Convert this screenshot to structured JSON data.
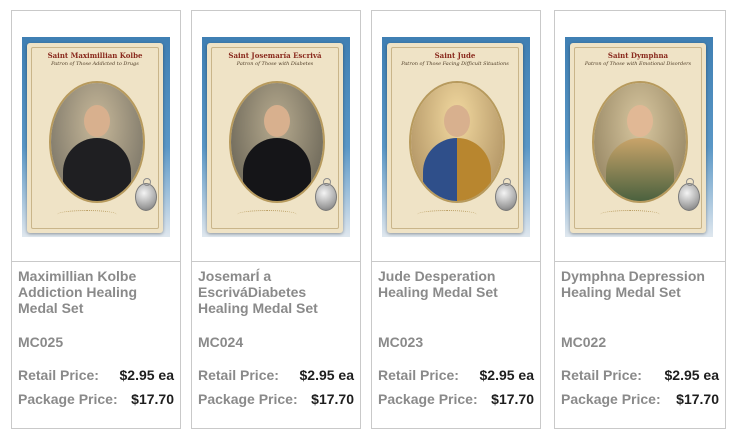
{
  "products": [
    {
      "card_saint": "Saint Maximillian Kolbe",
      "card_patron": "Patron of Those Addicted to Drugs",
      "title": "Maximillian Kolbe Addiction Healing Medal Set",
      "code": "MC025",
      "retail_label": "Retail Price:",
      "retail_price": "$2.95 ea",
      "package_label": "Package Price:",
      "package_price": "$17.70"
    },
    {
      "card_saint": "Saint Josemaría Escrivá",
      "card_patron": "Patron of Those with Diabetes",
      "title": "JosemarÍ a EscriváDiabetes Healing Medal Set",
      "code": "MC024",
      "retail_label": "Retail Price:",
      "retail_price": "$2.95 ea",
      "package_label": "Package Price:",
      "package_price": "$17.70"
    },
    {
      "card_saint": "Saint Jude",
      "card_patron": "Patron of Those Facing Difficult Situations",
      "title": "Jude Desperation Healing Medal Set",
      "code": "MC023",
      "retail_label": "Retail Price:",
      "retail_price": "$2.95 ea",
      "package_label": "Package Price:",
      "package_price": "$17.70"
    },
    {
      "card_saint": "Saint Dymphna",
      "card_patron": "Patron of Those with Emotional Disorders",
      "title": "Dymphna Depression Healing Medal Set",
      "code": "MC022",
      "retail_label": "Retail Price:",
      "retail_price": "$2.95 ea",
      "package_label": "Package Price:",
      "package_price": "$17.70"
    }
  ],
  "colors": {
    "text_gray": "#8a8a8a",
    "price_dark": "#1e1e1e",
    "border": "#c9c9c9",
    "card_parchment": "#efe3c6",
    "card_title_red": "#8a2a1e"
  }
}
